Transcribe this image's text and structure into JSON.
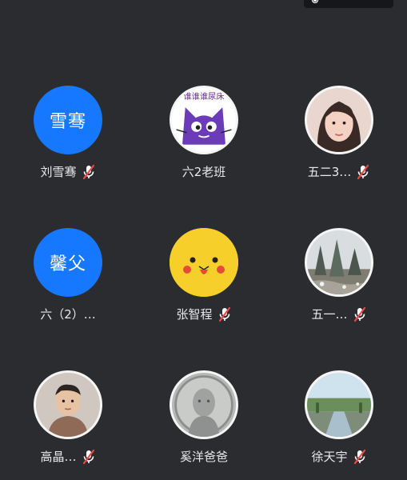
{
  "participants": [
    {
      "name": "刘雪骞",
      "avatar_text": "雪骞",
      "avatar_type": "text",
      "muted": true
    },
    {
      "name": "六2老班",
      "avatar_type": "image",
      "avatar_icon": "purple-cat-avatar",
      "avatar_caption": "谁谁谁尿床",
      "muted": false
    },
    {
      "name": "五二3…",
      "avatar_type": "image",
      "avatar_icon": "woman-photo-avatar",
      "muted": true
    },
    {
      "name": "六（2）…",
      "avatar_text": "馨父",
      "avatar_type": "text",
      "muted": false
    },
    {
      "name": "张智程",
      "avatar_type": "image",
      "avatar_icon": "pikachu-avatar",
      "muted": true
    },
    {
      "name": "五一…",
      "avatar_type": "image",
      "avatar_icon": "snowy-forest-avatar",
      "muted": true
    },
    {
      "name": "高晶…",
      "avatar_type": "image",
      "avatar_icon": "child-photo-avatar",
      "muted": true
    },
    {
      "name": "奚洋爸爸",
      "avatar_type": "image",
      "avatar_icon": "coin-portrait-avatar",
      "muted": false
    },
    {
      "name": "徐天宇",
      "avatar_type": "image",
      "avatar_icon": "canal-landscape-avatar",
      "muted": true
    }
  ],
  "colors": {
    "background": "#2b2c2f",
    "avatar_blue": "#1677ff",
    "mute_red": "#f04848",
    "text": "#e9e9ea"
  }
}
